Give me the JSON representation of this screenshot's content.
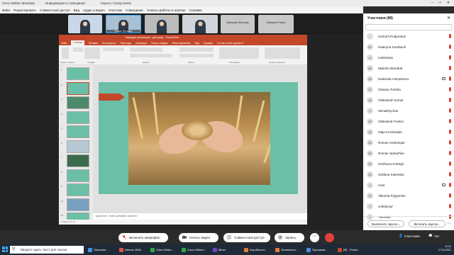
{
  "titlebar": {
    "app": "Cisco Webex Meetings",
    "info": "Информация о совещании",
    "hide": "Скрыть строку меню"
  },
  "menubar": [
    "Файл",
    "Редактировать",
    "Совместный доступ",
    "Вид",
    "Аудио и видео",
    "Участник",
    "Совещание",
    "Сеансы работы в группах",
    "Справка"
  ],
  "thumbnails": [
    {
      "name": ""
    },
    {
      "name": "Роман Бутавин"
    },
    {
      "name": ""
    },
    {
      "name": ""
    },
    {
      "name": "Oleksandr Shevchyn"
    },
    {
      "name": "Oleksandr Pavlov"
    }
  ],
  "ppt": {
    "title": "Бифидин регуляторы ..pptx [ред] – PowerPoint",
    "tabs": [
      "Файл",
      "Главная",
      "Вставка",
      "Конструктор",
      "Переходы",
      "Анимация",
      "Показ слайдов",
      "Рецензирование",
      "Вид",
      "Справка",
      "Что вы хотите сделать?"
    ],
    "ribbon_groups": [
      "Буфер обмена",
      "Слайды",
      "Шрифт",
      "Абзац",
      "Рисование",
      "Редактирование"
    ],
    "slide_numbers": [
      "1",
      "2",
      "3",
      "4",
      "5",
      "6",
      "7",
      "8",
      "9",
      "10",
      "11"
    ],
    "notes": "Щелкните, чтобы добавить заметки",
    "status": "Слайд 2 из 14"
  },
  "participants": {
    "header": "Участники (88)",
    "list": [
      {
        "initials": "",
        "name": "Hryhorii Podpriatov",
        "muted": true,
        "video": false
      },
      {
        "initials": "KS",
        "name": "Kateryna Surabach",
        "muted": true,
        "video": false
      },
      {
        "initials": "M",
        "name": "maksmtas",
        "muted": true,
        "video": false
      },
      {
        "initials": "MS",
        "name": "Mykola Starodub",
        "muted": true,
        "video": false
      },
      {
        "initials": "NA",
        "name": "Nadezda Antropheva",
        "muted": true,
        "video": true
      },
      {
        "initials": "OT",
        "name": "Oksana Torisha",
        "muted": true,
        "video": false
      },
      {
        "initials": "OK",
        "name": "Oleksandr Komar",
        "muted": true,
        "video": false
      },
      {
        "initials": "O",
        "name": "olenakhychan",
        "muted": true,
        "video": false
      },
      {
        "initials": "OP",
        "name": "Oleksandr Pavlov",
        "muted": true,
        "video": false
      },
      {
        "initials": "OK",
        "name": "Olga Kochkodan",
        "muted": true,
        "video": false
      },
      {
        "initials": "RA",
        "name": "Roman Andrusyak",
        "muted": true,
        "video": false
      },
      {
        "initials": "RS",
        "name": "Roman Spriazhka",
        "muted": true,
        "video": false
      },
      {
        "initials": "SK",
        "name": "Snizhana Kostsyk",
        "muted": true,
        "video": false
      },
      {
        "initials": "SK",
        "name": "Svitlana Kalenska",
        "muted": true,
        "video": false
      },
      {
        "initials": "U",
        "name": "User",
        "muted": true,
        "video": true
      },
      {
        "initials": "VP",
        "name": "Viktoriia Pylypenko",
        "muted": true,
        "video": false
      },
      {
        "initials": "V",
        "name": "voledymyr",
        "muted": true,
        "video": false
      },
      {
        "initials": "Y",
        "name": "Yaroslav",
        "muted": true,
        "video": false
      }
    ],
    "mute_all": "Выключить звук во...",
    "unmute_all": "Включить звук во..."
  },
  "controls": {
    "mic": "Включить микрофон",
    "video": "Начать видео",
    "share": "Совместный доступ",
    "record": "Запись",
    "participants": "Участники",
    "chat": "Чат"
  },
  "taskbar": {
    "search": "Введите здесь текст для поиска",
    "apps": [
      {
        "label": "Прескоки ...",
        "color": "#4a90d9"
      },
      {
        "label": "Demon 1804",
        "color": "#d9534f"
      },
      {
        "label": "Cisco Webe...",
        "color": "#2ba84a"
      },
      {
        "label": "Cisco Webex...",
        "color": "#2ba84a"
      },
      {
        "label": "Miner",
        "color": "#6f42c1"
      },
      {
        "label": "Агробиолог...",
        "color": "#e07b39"
      },
      {
        "label": "Оновлення ...",
        "color": "#e07b39"
      },
      {
        "label": "Програми...",
        "color": "#4a90d9"
      },
      {
        "label": "[Ф] - Power...",
        "color": "#c3482a"
      }
    ],
    "time": "11:21",
    "date": "17.04.2021"
  }
}
